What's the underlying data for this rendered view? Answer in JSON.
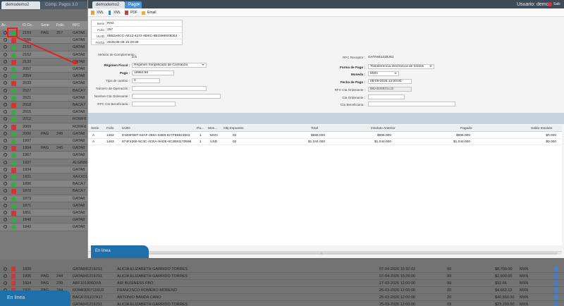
{
  "app": {
    "tabs": [
      "demodemo2",
      "Comp. Pagos 3.0"
    ],
    "user_label": "Usuario: demo",
    "salir": "Salir",
    "status_badge": "En linea"
  },
  "background_grid": {
    "headers": [
      "Ac..",
      "ID Co..",
      "Serie",
      "Folio",
      "RFC"
    ],
    "rows": [
      {
        "id": "2159",
        "serie": "PAG",
        "folio": "257",
        "rfc": "GATA8"
      },
      {
        "id": "2156",
        "serie": "",
        "folio": "",
        "rfc": "GATA8"
      },
      {
        "id": "2153",
        "serie": "",
        "folio": "",
        "rfc": "GATA8"
      },
      {
        "id": "2152",
        "serie": "",
        "folio": "",
        "rfc": "GATA8"
      },
      {
        "id": "2132",
        "serie": "",
        "folio": "",
        "rfc": "GATA8"
      },
      {
        "id": "2057",
        "serie": "",
        "folio": "",
        "rfc": "GATA8"
      },
      {
        "id": "2054",
        "serie": "",
        "folio": "",
        "rfc": "GATA8"
      },
      {
        "id": "2033",
        "serie": "",
        "folio": "",
        "rfc": "GATA8"
      },
      {
        "id": "2027",
        "serie": "",
        "folio": "",
        "rfc": "BACA7"
      },
      {
        "id": "2021",
        "serie": "",
        "folio": "",
        "rfc": "GATA8"
      },
      {
        "id": "2018",
        "serie": "",
        "folio": "",
        "rfc": "BACA7"
      },
      {
        "id": "2015",
        "serie": "",
        "folio": "",
        "rfc": "GATA8"
      },
      {
        "id": "2012",
        "serie": "",
        "folio": "",
        "rfc": "ROMF8"
      },
      {
        "id": "2009",
        "serie": "",
        "folio": "",
        "rfc": "ROMF8"
      },
      {
        "id": "2000",
        "serie": "PAG",
        "folio": "249",
        "rfc": "GATA8"
      },
      {
        "id": "1997",
        "serie": "",
        "folio": "",
        "rfc": "GATA8"
      },
      {
        "id": "1994",
        "serie": "PAG",
        "folio": "246",
        "rfc": "GATA8"
      },
      {
        "id": "1967",
        "serie": "",
        "folio": "",
        "rfc": "GATA8"
      },
      {
        "id": "1937",
        "serie": "",
        "folio": "",
        "rfc": "ALGB80"
      },
      {
        "id": "1934",
        "serie": "",
        "folio": "",
        "rfc": "GATA8"
      },
      {
        "id": "1931",
        "serie": "",
        "folio": "",
        "rfc": "XAXX01"
      },
      {
        "id": "1896",
        "serie": "",
        "folio": "",
        "rfc": "BACA7"
      },
      {
        "id": "1878",
        "serie": "",
        "folio": "",
        "rfc": "BACA7"
      },
      {
        "id": "1873",
        "serie": "",
        "folio": "",
        "rfc": "GATA8"
      },
      {
        "id": "1871",
        "serie": "",
        "folio": "",
        "rfc": "GATA8"
      },
      {
        "id": "1851",
        "serie": "",
        "folio": "",
        "rfc": "GATA8"
      },
      {
        "id": "1848",
        "serie": "",
        "folio": "",
        "rfc": "GATA8"
      },
      {
        "id": "1842",
        "serie": "",
        "folio": "",
        "rfc": "GATA8"
      }
    ],
    "bottom_rows": [
      {
        "id": "1939",
        "serie": "",
        "folio": "",
        "rfc": "GATA841219JS1",
        "name": "ALICIA ELIZABETH GARRIDO TORRES",
        "date": "07-04-2026 15:32:02",
        "pct": "99",
        "amount": "$8,700.00",
        "cur": "MXN"
      },
      {
        "id": "1936",
        "serie": "PAG",
        "folio": "244",
        "rfc": "GATA841219JS1",
        "name": "ALICIA ELIZABETH GARRIDO TORRES",
        "date": "07-04-2026 15:26:00",
        "pct": "99",
        "amount": "$2,900.00",
        "cur": "MXN"
      },
      {
        "id": "1924",
        "serie": "PAG",
        "folio": "239",
        "rfc": "ABF101006DXA",
        "name": "AIR BUSINESS FBO",
        "date": "27-03-2026 12:00:00",
        "pct": "99",
        "amount": "$92.66",
        "cur": "MXN"
      },
      {
        "id": "1921",
        "serie": "PAG",
        "folio": "244",
        "rfc": "ROMF8207116U3",
        "name": "FRANCISCO ROMERO MORENO",
        "date": "26-03-2026 12:00:00",
        "pct": "20",
        "amount": "$4,663.12",
        "cur": "MXN"
      },
      {
        "id": "",
        "serie": "",
        "folio": "",
        "rfc": "BACA701107A17",
        "name": "ANTONIO BANDA CANO",
        "date": "25-03-2026 12:00:00",
        "pct": "20",
        "amount": "$40,550.00",
        "cur": "MXN"
      },
      {
        "id": "",
        "serie": "",
        "folio": "",
        "rfc": "GATA841219JS1",
        "name": "ALICIA ELIZABETH GARRIDO TORRES",
        "date": "25-03-2026 12:00:00",
        "pct": "03",
        "amount": "$23,200.00",
        "cur": "MXN"
      }
    ]
  },
  "modal": {
    "tabs": [
      "demodemo2",
      "Pago"
    ],
    "user_label": "Usuario: demo",
    "salir": "Salir",
    "toolbar": [
      {
        "label": "XML",
        "icon": "xml-icon"
      },
      {
        "label": "XML",
        "icon": "download-icon"
      },
      {
        "label": "PDF",
        "icon": "pdf-icon"
      },
      {
        "label": "Email",
        "icon": "email-icon"
      }
    ],
    "info": [
      {
        "k": "Serie",
        "v": "PAG"
      },
      {
        "k": "Folio",
        "v": "257"
      },
      {
        "k": "UUID",
        "v": "05B2A6CC-AE12-4172-8DEC-5B1598933DE4"
      },
      {
        "k": "Fecha",
        "v": "2026-05-08 15:29:36"
      }
    ],
    "left_fields": {
      "version_label": "Versión de Complemento :",
      "version": "2.0",
      "regimen_label": "Régimen Fiscal :",
      "regimen": "Régimen Simplificado de Confianza",
      "pago_label": "Pago :",
      "pago": "18984.56",
      "tipo_cambio_label": "Tipo de cambio :",
      "tipo_cambio": "0",
      "num_op_label": "Número de Operación :",
      "num_op": "",
      "nombre_banco_label": "Nombre Cta Ordenante :",
      "nombre_banco": "",
      "rfc_benef_label": "RFC Cta Beneficiaria :",
      "rfc_benef": ""
    },
    "right_fields": {
      "rfc_receptor_label": "RFC Receptor :",
      "rfc_receptor": "GATA841219JS1",
      "forma_pago_label": "Forma de Pago :",
      "forma_pago": "Transferencia electrónica de fondos",
      "moneda_label": "Moneda :",
      "moneda": "MXN",
      "fecha_pago_label": "Fecha de Pago :",
      "fecha_pago": "08-05-2026 12:00:00",
      "rfc_ord_label": "RFC Cta Ordenante :",
      "rfc_ord": "BBA830831LJ2",
      "cta_ord_label": "Cta Ordenante :",
      "cta_ord": "",
      "cta_benef_label": "Cta Beneficiaria :",
      "cta_benef": ""
    },
    "detail_headers": [
      "Serie",
      "Folio",
      "UUID",
      "Pa...",
      "Mon...",
      "Obj Impuesto",
      "Total",
      "Insoluto Anterior",
      "Pagado",
      "Saldo Insoluto"
    ],
    "detail_rows": [
      {
        "serie": "A",
        "folio": "1462",
        "uuid": "D1B6FB87-50AF-469A-94B8-827FB8923502",
        "pa": "1",
        "mon": "MXN",
        "obj": "02",
        "total": "$986.000",
        "ant": "$986.000",
        "pagado": "$986.000",
        "saldo": "$0.000"
      },
      {
        "serie": "A",
        "folio": "1463",
        "uuid": "874F2265-5C3C-4CEA-9ADE-6C2B81173596",
        "pa": "1",
        "mon": "USD",
        "obj": "02",
        "total": "$1,044.000",
        "ant": "$1,044.000",
        "pagado": "$1,044.000",
        "saldo": "$0.000"
      }
    ],
    "status_badge": "En linea"
  },
  "colors": {
    "accent": "#4a92d0",
    "status_online": "#1f6fa8",
    "annotation": "#ff1414"
  }
}
